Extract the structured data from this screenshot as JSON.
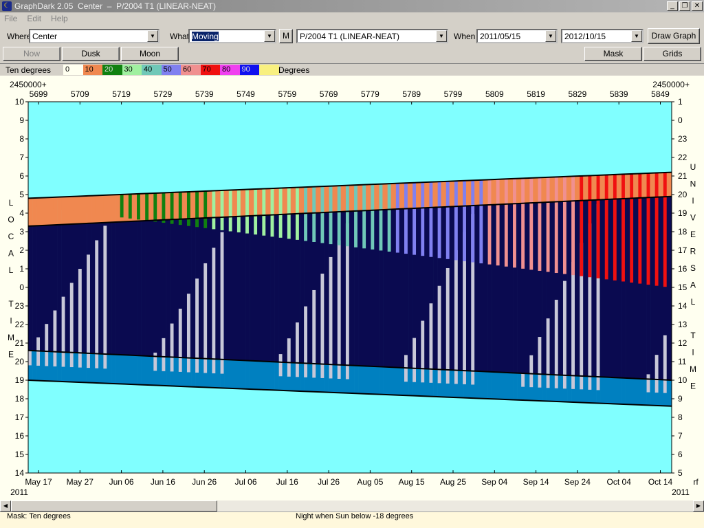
{
  "window": {
    "title": "GraphDark 2.05  Center  –  P/2004 T1 (LINEAR-NEAT)",
    "minimize": "_",
    "restore": "❐",
    "close": "✕"
  },
  "menu": [
    "File",
    "Edit",
    "Help"
  ],
  "toolbar": {
    "where_label": "Where",
    "where_value": "Center",
    "what_label": "What",
    "what_value": "Moving",
    "m_button": "M",
    "object_value": "P/2004 T1 (LINEAR-NEAT)",
    "when_label": "When",
    "start_date": "2011/05/15",
    "end_date": "2012/10/15",
    "draw_button": "Draw Graph"
  },
  "toolbar2": {
    "now": "Now",
    "dusk": "Dusk",
    "moon": "Moon",
    "mask": "Mask",
    "grids": "Grids"
  },
  "legend": {
    "label": "Ten degrees",
    "units": "Degrees",
    "items": [
      {
        "text": "0",
        "color": "#fffff0"
      },
      {
        "text": "10",
        "color": "#f08850"
      },
      {
        "text": "20",
        "color": "#108010"
      },
      {
        "text": "30",
        "color": "#a0f0a0"
      },
      {
        "text": "40",
        "color": "#70c8b8"
      },
      {
        "text": "50",
        "color": "#8080f0"
      },
      {
        "text": "60",
        "color": "#f09090"
      },
      {
        "text": "70",
        "color": "#f01010"
      },
      {
        "text": "80",
        "color": "#f040f0"
      },
      {
        "text": "90",
        "color": "#1010f0"
      },
      {
        "text": "",
        "color": "#f8f080"
      }
    ]
  },
  "chart_data": {
    "type": "heatmap",
    "jd_prefix_left": "2450000+",
    "jd_prefix_right": "2450000+",
    "jd_ticks": [
      "5699",
      "5709",
      "5719",
      "5729",
      "5739",
      "5749",
      "5759",
      "5769",
      "5779",
      "5789",
      "5799",
      "5809",
      "5819",
      "5829",
      "5839",
      "5849"
    ],
    "date_ticks": [
      "May 17",
      "May 27",
      "Jun 06",
      "Jun 16",
      "Jun 26",
      "Jul 06",
      "Jul 16",
      "Jul 26",
      "Aug 05",
      "Aug 15",
      "Aug 25",
      "Sep 04",
      "Sep 14",
      "Sep 24",
      "Oct 04",
      "Oct 14"
    ],
    "year_left": "2011",
    "year_right": "2011",
    "right_corner": "rf",
    "local_ticks": [
      "10",
      "9",
      "8",
      "7",
      "6",
      "5",
      "4",
      "3",
      "2",
      "1",
      "0",
      "23",
      "22",
      "21",
      "20",
      "19",
      "18",
      "17",
      "16",
      "15",
      "14"
    ],
    "ut_ticks": [
      "1",
      "0",
      "23",
      "22",
      "21",
      "20",
      "19",
      "18",
      "17",
      "16",
      "15",
      "14",
      "13",
      "12",
      "11",
      "10",
      "9",
      "8",
      "7",
      "6",
      "5"
    ],
    "left_axis_title": [
      "L",
      "O",
      "C",
      "A",
      "L",
      "",
      "T",
      "I",
      "M",
      "E"
    ],
    "right_axis_title": [
      "U",
      "N",
      "I",
      "V",
      "E",
      "R",
      "S",
      "A",
      "L",
      "",
      "T",
      "I",
      "M",
      "E"
    ],
    "days": 154,
    "sunset_start": 19.0,
    "sunset_end": 17.6,
    "dusk_start": 20.6,
    "dusk_end": 19.0,
    "dawn_start": 3.3,
    "dawn_end": 4.9,
    "sunrise_start": 4.8,
    "sunrise_end": 6.2,
    "obj_set_start": 4.4,
    "obj_set_end": 0.0
  },
  "status": {
    "mask": "Mask:  Ten degrees",
    "night": "Night when Sun below -18 degrees"
  }
}
